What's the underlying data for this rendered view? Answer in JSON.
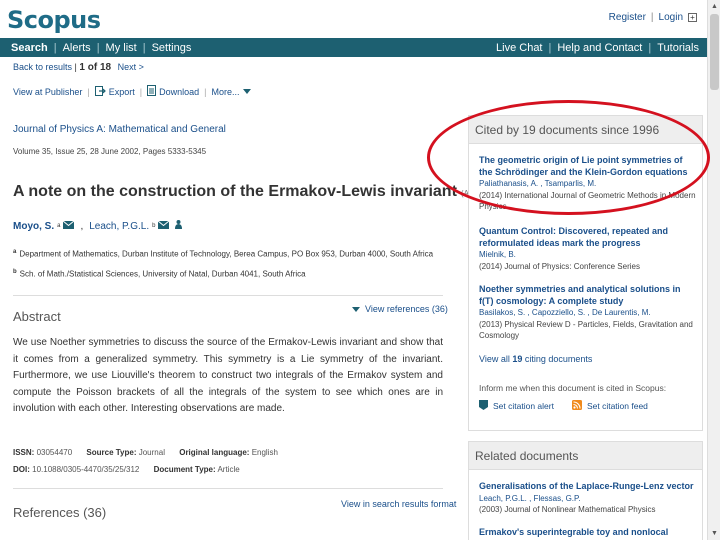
{
  "header": {
    "logo": "Scopus",
    "register": "Register",
    "login": "Login"
  },
  "nav": {
    "left": [
      "Search",
      "Alerts",
      "My list",
      "Settings"
    ],
    "right": [
      "Live Chat",
      "Help and Contact",
      "Tutorials"
    ],
    "active": "Search"
  },
  "results": {
    "back": "Back to results",
    "position": "1 of 18",
    "next": "Next >"
  },
  "actions": {
    "view_publisher": "View at Publisher",
    "export": "Export",
    "download": "Download",
    "more": "More..."
  },
  "article": {
    "journal": "Journal of Physics A: Mathematical and General",
    "volume": "Volume 35, Issue 25, 28 June 2002, Pages 5333-5345",
    "title": "A note on the construction of the Ermakov-Lewis invariant",
    "type_tag": "(Article)",
    "authors": [
      {
        "name": "Moyo, S.",
        "sup": "a"
      },
      {
        "name": "Leach, P.G.L.",
        "sup": "b"
      }
    ],
    "affiliations": [
      {
        "sup": "a",
        "text": "Department of Mathematics, Durban Institute of Technology, Berea Campus, PO Box 953, Durban 4000, South Africa"
      },
      {
        "sup": "b",
        "text": "Sch. of Math./Statistical Sciences, University of Natal, Durban 4041, South Africa"
      }
    ]
  },
  "abstract": {
    "heading": "Abstract",
    "view_refs": "View references (36)",
    "text": "We use Noether symmetries to discuss the source of the Ermakov-Lewis invariant and show that it comes from a generalized symmetry. This symmetry is a Lie symmetry of the invariant. Furthermore, we use Liouville's theorem to construct two integrals of the Ermakov system and compute the Poisson brackets of all the integrals of the system to see which ones are in involution with each other. Interesting observations are made."
  },
  "meta": {
    "issn_label": "ISSN:",
    "issn": "03054470",
    "source_label": "Source Type:",
    "source": "Journal",
    "lang_label": "Original language:",
    "lang": "English",
    "doi_label": "DOI:",
    "doi": "10.1088/0305-4470/35/25/312",
    "doctype_label": "Document Type:",
    "doctype": "Article"
  },
  "references": {
    "heading": "References (36)",
    "link": "View in search results format"
  },
  "cited": {
    "heading": "Cited by 19 documents since 1996",
    "docs": [
      {
        "title": "The geometric origin of Lie point symmetries of the Schrödinger and the Klein-Gordon equations",
        "authors": "Paliathanasis, A. , Tsamparlis, M.",
        "source": "(2014) International Journal of Geometric Methods in Modern Physics"
      },
      {
        "title": "Quantum Control: Discovered, repeated and reformulated ideas mark the progress",
        "authors": "Mielnik, B.",
        "source": "(2014) Journal of Physics: Conference Series"
      },
      {
        "title": "Noether symmetries and analytical solutions in f(T) cosmology: A complete study",
        "authors": "Basilakos, S. , Capozziello, S. , De Laurentis, M.",
        "source": "(2013) Physical Review D - Particles, Fields, Gravitation and Cosmology"
      }
    ],
    "view_all_prefix": "View all ",
    "view_all_count": "19",
    "view_all_suffix": " citing documents",
    "inform": "Inform me when this document is cited in Scopus:",
    "set_alert": "Set citation alert",
    "set_feed": "Set citation feed"
  },
  "related": {
    "heading": "Related documents",
    "docs": [
      {
        "title": "Generalisations of the Laplace-Runge-Lenz vector",
        "authors": "Leach, P.G.L. , Flessas, G.P.",
        "source": "(2003) Journal of Nonlinear Mathematical Physics"
      },
      {
        "title": "Ermakov's superintegrable toy and nonlocal"
      }
    ]
  },
  "colors": {
    "brand_teal": "#1d6071",
    "logo": "#1f6c87",
    "link": "#1a4f8a",
    "highlight": "#d4111f"
  }
}
